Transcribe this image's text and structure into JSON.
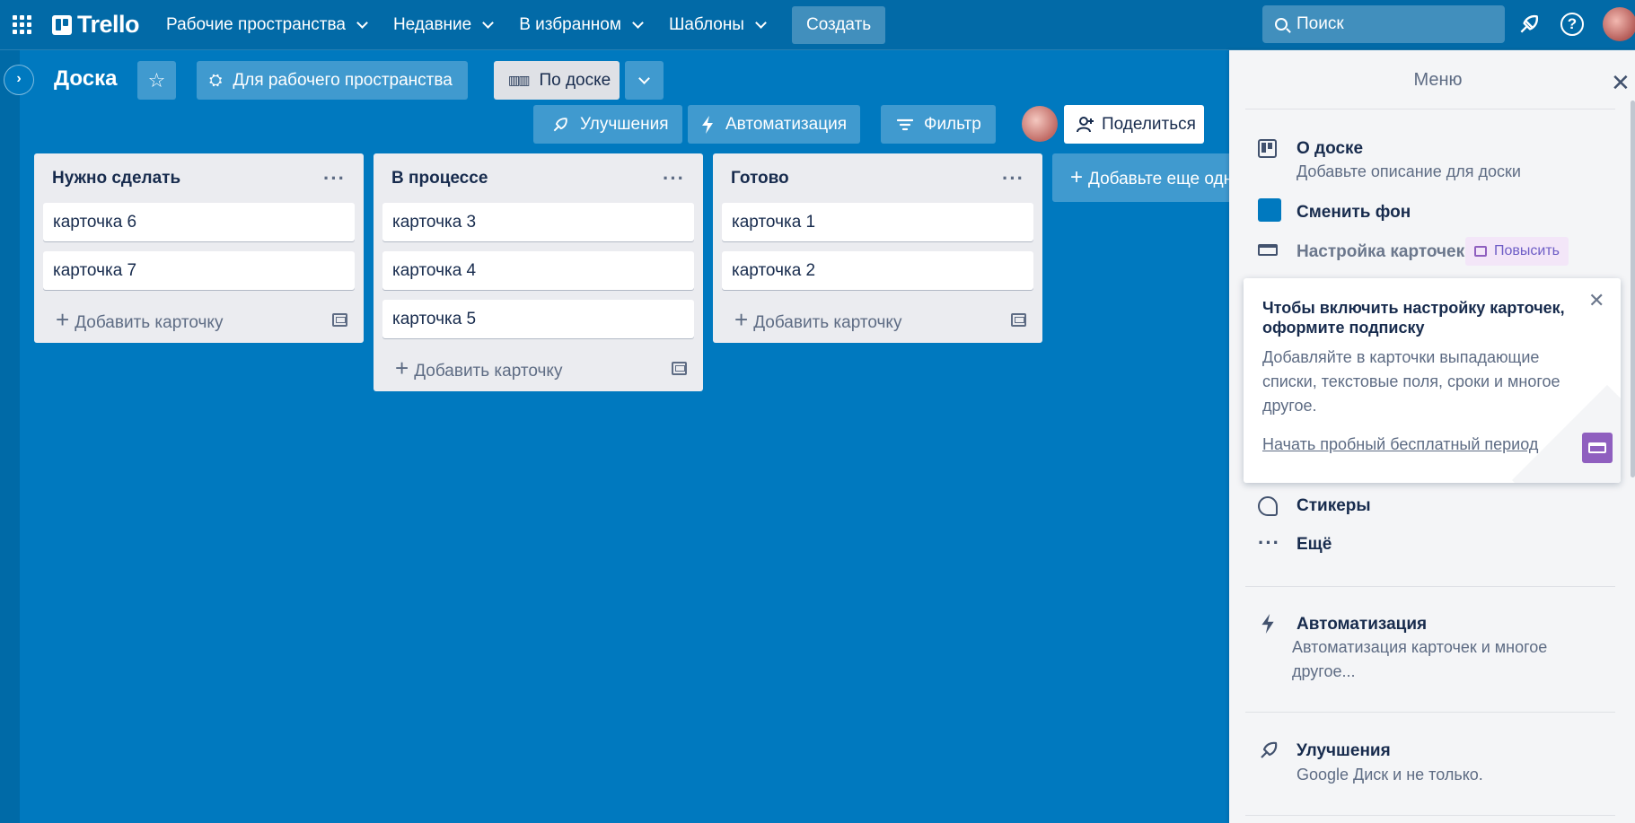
{
  "topbar": {
    "logo": "Trello",
    "nav": [
      {
        "label": "Рабочие пространства"
      },
      {
        "label": "Недавние"
      },
      {
        "label": "В избранном"
      },
      {
        "label": "Шаблоны"
      }
    ],
    "create": "Создать",
    "search_placeholder": "Поиск"
  },
  "board": {
    "title": "Доска",
    "workspace_btn": "Для рабочего пространства",
    "view_btn": "По доске",
    "powerups": "Улучшения",
    "automation": "Автоматизация",
    "filter": "Фильтр",
    "share": "Поделиться"
  },
  "lists": [
    {
      "title": "Нужно сделать",
      "cards": [
        "карточка 6",
        "карточка 7"
      ],
      "add": "Добавить карточку"
    },
    {
      "title": "В процессе",
      "cards": [
        "карточка 3",
        "карточка 4",
        "карточка 5"
      ],
      "add": "Добавить карточку"
    },
    {
      "title": "Готово",
      "cards": [
        "карточка 1",
        "карточка 2"
      ],
      "add": "Добавить карточку"
    }
  ],
  "add_list": "Добавьте еще одну колонку",
  "menu": {
    "title": "Меню",
    "about_title": "О доске",
    "about_desc": "Добавьте описание для доски",
    "background": "Сменить фон",
    "card_settings": "Настройка карточек",
    "upgrade": "Повысить",
    "popup_title": "Чтобы включить настройку карточек, оформите подписку",
    "popup_body": "Добавляйте в карточки выпадающие списки, текстовые поля, сроки и многое другое.",
    "popup_link": "Начать пробный бесплатный период",
    "stickers": "Стикеры",
    "more": "Ещё",
    "automation_title": "Автоматизация",
    "automation_desc": "Автоматизация карточек и многое другое...",
    "powerups_title": "Улучшения",
    "powerups_desc": "Google Диск и не только."
  },
  "colors": {
    "board_bg": "#0079bf",
    "header_bg": "#026aa7",
    "upgrade_purple": "#8f5fbf"
  }
}
